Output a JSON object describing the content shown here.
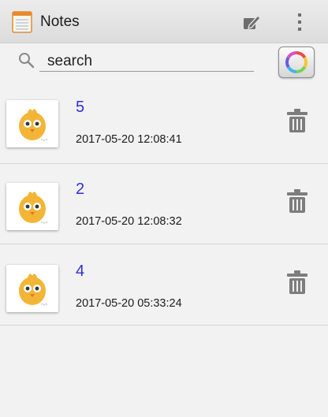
{
  "app": {
    "title": "Notes",
    "icon": "notepad-icon"
  },
  "toolbar": {
    "edit_icon": "edit-icon",
    "more_icon": "overflow-menu-icon"
  },
  "search": {
    "placeholder": "search",
    "icon": "search-icon",
    "color_button_icon": "color-wheel-icon"
  },
  "notes": [
    {
      "title": "5",
      "date": "2017-05-20 12:08:41"
    },
    {
      "title": "2",
      "date": "2017-05-20 12:08:32"
    },
    {
      "title": "4",
      "date": "2017-05-20 05:33:24"
    }
  ],
  "colors": {
    "title": "#2f2fd9",
    "appbar": "#e3e3e3",
    "background": "#f2f2f2"
  }
}
